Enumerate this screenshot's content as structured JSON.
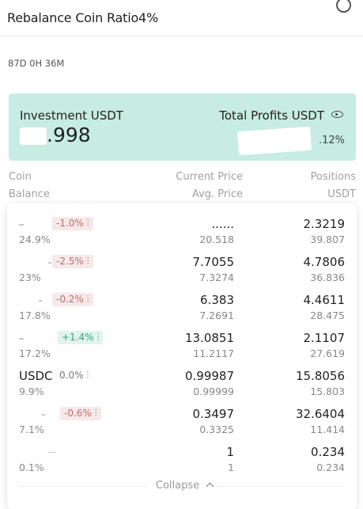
{
  "header": {
    "title": "Rebalance Coin Ratio4%"
  },
  "duration": "87D 0H 36M",
  "summary": {
    "investment_label": "Investment USDT",
    "investment_value": ".998",
    "profits_label": "Total Profits USDT",
    "profits_pct": ".12%"
  },
  "columns": {
    "coin": "Coin",
    "balance": "Balance",
    "current_price": "Current Price",
    "avg_price": "Avg. Price",
    "positions": "Positions",
    "usdt": "USDT"
  },
  "rows": [
    {
      "coin": "",
      "change": "-1.0%",
      "trend": "neg",
      "share": "24.9%",
      "price": "......",
      "avg": "20.518",
      "pos": "2.3219",
      "usdt": "39.807"
    },
    {
      "coin": "",
      "change": "-2.5%",
      "trend": "neg",
      "share": "23%",
      "price": "7.7055",
      "avg": "7.3274",
      "pos": "4.7806",
      "usdt": "36.836"
    },
    {
      "coin": "",
      "change": "-0.2%",
      "trend": "neg",
      "share": "17.8%",
      "price": "6.383",
      "avg": "7.2691",
      "pos": "4.4611",
      "usdt": "28.475"
    },
    {
      "coin": "",
      "change": "+1.4%",
      "trend": "pos",
      "share": "17.2%",
      "price": "13.0851",
      "avg": "11.2117",
      "pos": "2.1107",
      "usdt": "27.619"
    },
    {
      "coin": "USDC",
      "change": "0.0%",
      "trend": "zero",
      "share": "9.9%",
      "price": "0.99987",
      "avg": "0.99999",
      "pos": "15.8056",
      "usdt": "15.803"
    },
    {
      "coin": "",
      "change": "-0.6%",
      "trend": "neg",
      "share": "7.1%",
      "price": "0.3497",
      "avg": "0.3325",
      "pos": "32.6404",
      "usdt": "11.414"
    },
    {
      "coin": "",
      "change": "",
      "trend": "none",
      "share": "0.1%",
      "price": "1",
      "avg": "1",
      "pos": "0.234",
      "usdt": "0.234"
    }
  ],
  "footer": {
    "collapse": "Collapse"
  },
  "icons": {
    "info": "info-circle-icon",
    "eye": "eye-icon",
    "chart": "candlestick-icon",
    "collapse": "chevron-up-icon"
  },
  "colors": {
    "accent": "#c7ece3",
    "negative": "#bf6d6d",
    "positive": "#3d9f7f"
  }
}
